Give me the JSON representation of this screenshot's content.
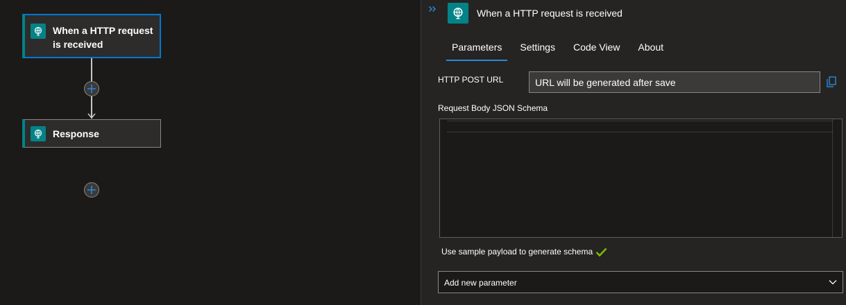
{
  "canvas": {
    "trigger_card": {
      "title_line1": "When a HTTP request",
      "title_line2": "is received",
      "icon": "globe-request-icon"
    },
    "action_card": {
      "title": "Response",
      "icon": "globe-request-icon"
    },
    "add_step_icon": "plus-icon"
  },
  "panel": {
    "collapse_icon": "double-chevron-right-icon",
    "title": "When a HTTP request is received",
    "tabs": [
      {
        "label": "Parameters",
        "active": true
      },
      {
        "label": "Settings",
        "active": false
      },
      {
        "label": "Code View",
        "active": false
      },
      {
        "label": "About",
        "active": false
      }
    ],
    "http_post_url_label": "HTTP POST URL",
    "http_post_url_value": "URL will be generated after save",
    "schema_label": "Request Body JSON Schema",
    "sample_payload_link": "Use sample payload to generate schema",
    "add_parameter_placeholder": "Add new parameter"
  },
  "colors": {
    "accent": "#2b88d8",
    "selected_border": "#0078d4",
    "connector_icon_bg": "#038387",
    "check": "#7fba00"
  }
}
